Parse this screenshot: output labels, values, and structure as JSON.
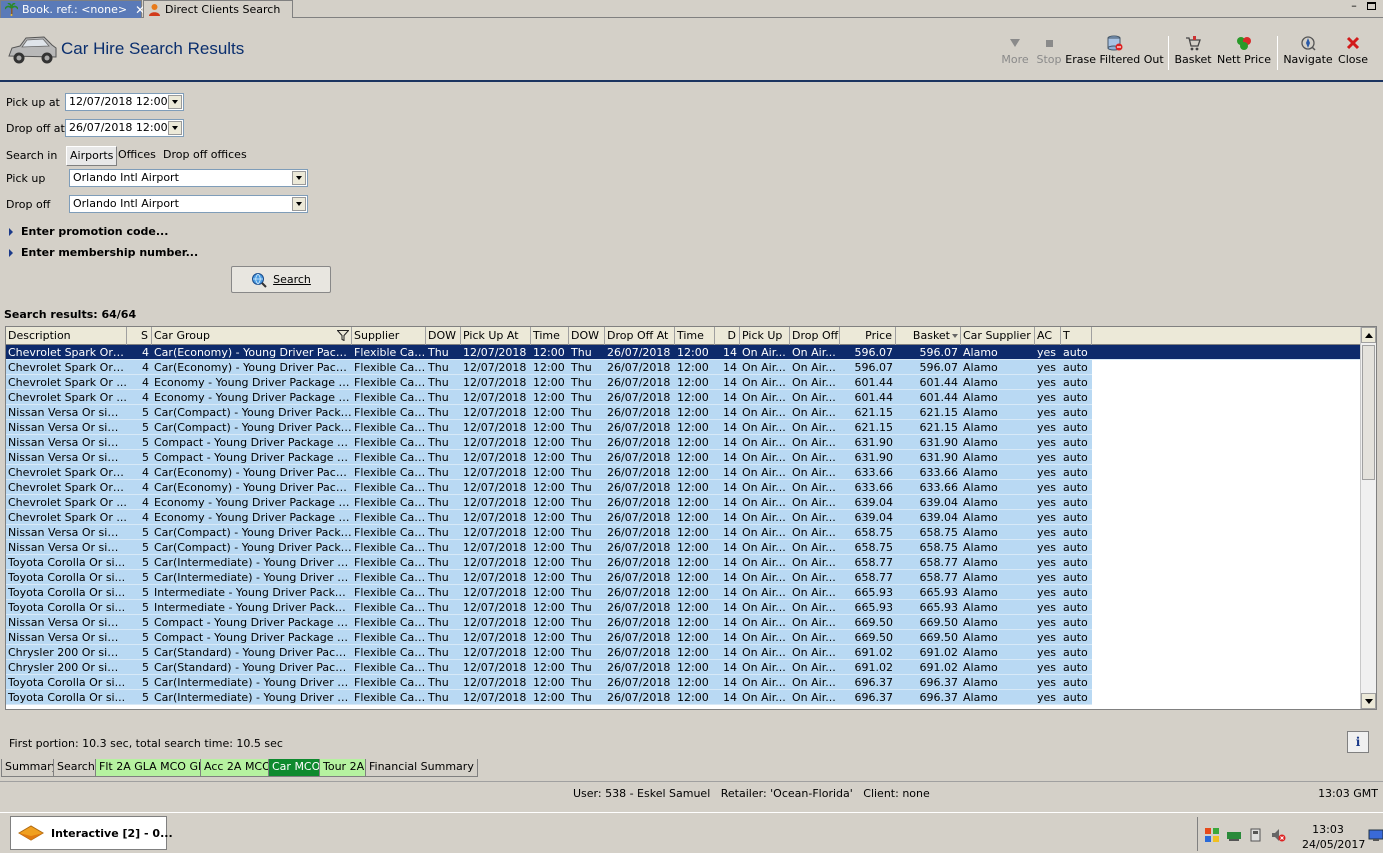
{
  "doc_tabs": [
    {
      "label": "Book. ref.: <none>",
      "active": true
    },
    {
      "label": "Direct Clients Search",
      "active": false
    }
  ],
  "header": {
    "title": "Car Hire Search Results"
  },
  "toolbar": {
    "more": "More",
    "stop": "Stop",
    "erase": "Erase Filtered Out",
    "basket": "Basket",
    "nett": "Nett Price",
    "navigate": "Navigate",
    "close": "Close"
  },
  "form": {
    "pickup_at_label": "Pick up at",
    "pickup_at_value": "12/07/2018 12:00",
    "dropoff_at_label": "Drop off at",
    "dropoff_at_value": "26/07/2018 12:00",
    "search_in_label": "Search in",
    "search_in_options": [
      "Airports",
      "Offices",
      "Drop off offices"
    ],
    "pickup_label": "Pick up",
    "pickup_value": "Orlando Intl Airport",
    "dropoff_label": "Drop off",
    "dropoff_value": "Orlando Intl Airport",
    "promo": "Enter promotion code...",
    "membership": "Enter membership number...",
    "search_button": "Search"
  },
  "results": {
    "count": "Search results: 64/64",
    "columns": [
      "Description",
      "S",
      "Car Group",
      "Supplier",
      "DOW",
      "Pick Up At",
      "Time",
      "DOW",
      "Drop Off At",
      "Time",
      "D",
      "Pick Up",
      "Drop Off",
      "Price",
      "Basket",
      "Car Supplier",
      "AC",
      "T"
    ],
    "rows": [
      [
        "Chevrolet Spark Or si...",
        "4",
        "Car(Economy) - Young Driver Packag...",
        "Flexible Car...",
        "Thu",
        "12/07/2018",
        "12:00",
        "Thu",
        "26/07/2018",
        "12:00",
        "14",
        "On Air...",
        "On Air...",
        "596.07",
        "596.07",
        "Alamo",
        "yes",
        "auto"
      ],
      [
        "Chevrolet Spark Or si...",
        "4",
        "Car(Economy) - Young Driver Packag...",
        "Flexible Car...",
        "Thu",
        "12/07/2018",
        "12:00",
        "Thu",
        "26/07/2018",
        "12:00",
        "14",
        "On Air...",
        "On Air...",
        "596.07",
        "596.07",
        "Alamo",
        "yes",
        "auto"
      ],
      [
        "Chevrolet  Spark Or ...",
        "4",
        "Economy - Young Driver Package (ag...",
        "Flexible Car...",
        "Thu",
        "12/07/2018",
        "12:00",
        "Thu",
        "26/07/2018",
        "12:00",
        "14",
        "On Air...",
        "On Air...",
        "601.44",
        "601.44",
        "Alamo",
        "yes",
        "auto"
      ],
      [
        "Chevrolet  Spark Or ...",
        "4",
        "Economy - Young Driver Package (ag...",
        "Flexible Car...",
        "Thu",
        "12/07/2018",
        "12:00",
        "Thu",
        "26/07/2018",
        "12:00",
        "14",
        "On Air...",
        "On Air...",
        "601.44",
        "601.44",
        "Alamo",
        "yes",
        "auto"
      ],
      [
        "Nissan Versa Or simil...",
        "5",
        "Car(Compact) - Young Driver Package...",
        "Flexible Car...",
        "Thu",
        "12/07/2018",
        "12:00",
        "Thu",
        "26/07/2018",
        "12:00",
        "14",
        "On Air...",
        "On Air...",
        "621.15",
        "621.15",
        "Alamo",
        "yes",
        "auto"
      ],
      [
        "Nissan Versa Or simil...",
        "5",
        "Car(Compact) - Young Driver Package...",
        "Flexible Car...",
        "Thu",
        "12/07/2018",
        "12:00",
        "Thu",
        "26/07/2018",
        "12:00",
        "14",
        "On Air...",
        "On Air...",
        "621.15",
        "621.15",
        "Alamo",
        "yes",
        "auto"
      ],
      [
        "Nissan Versa Or simil...",
        "5",
        "Compact - Young Driver Package (age...",
        "Flexible Car...",
        "Thu",
        "12/07/2018",
        "12:00",
        "Thu",
        "26/07/2018",
        "12:00",
        "14",
        "On Air...",
        "On Air...",
        "631.90",
        "631.90",
        "Alamo",
        "yes",
        "auto"
      ],
      [
        "Nissan Versa Or simil...",
        "5",
        "Compact - Young Driver Package (age...",
        "Flexible Car...",
        "Thu",
        "12/07/2018",
        "12:00",
        "Thu",
        "26/07/2018",
        "12:00",
        "14",
        "On Air...",
        "On Air...",
        "631.90",
        "631.90",
        "Alamo",
        "yes",
        "auto"
      ],
      [
        "Chevrolet Spark Or si...",
        "4",
        "Car(Economy) - Young Driver Packag...",
        "Flexible Car...",
        "Thu",
        "12/07/2018",
        "12:00",
        "Thu",
        "26/07/2018",
        "12:00",
        "14",
        "On Air...",
        "On Air...",
        "633.66",
        "633.66",
        "Alamo",
        "yes",
        "auto"
      ],
      [
        "Chevrolet Spark Or si...",
        "4",
        "Car(Economy) - Young Driver Packag...",
        "Flexible Car...",
        "Thu",
        "12/07/2018",
        "12:00",
        "Thu",
        "26/07/2018",
        "12:00",
        "14",
        "On Air...",
        "On Air...",
        "633.66",
        "633.66",
        "Alamo",
        "yes",
        "auto"
      ],
      [
        "Chevrolet  Spark Or ...",
        "4",
        "Economy - Young Driver Package (ag...",
        "Flexible Car...",
        "Thu",
        "12/07/2018",
        "12:00",
        "Thu",
        "26/07/2018",
        "12:00",
        "14",
        "On Air...",
        "On Air...",
        "639.04",
        "639.04",
        "Alamo",
        "yes",
        "auto"
      ],
      [
        "Chevrolet  Spark Or ...",
        "4",
        "Economy - Young Driver Package (ag...",
        "Flexible Car...",
        "Thu",
        "12/07/2018",
        "12:00",
        "Thu",
        "26/07/2018",
        "12:00",
        "14",
        "On Air...",
        "On Air...",
        "639.04",
        "639.04",
        "Alamo",
        "yes",
        "auto"
      ],
      [
        "Nissan Versa Or simil...",
        "5",
        "Car(Compact) - Young Driver Package...",
        "Flexible Car...",
        "Thu",
        "12/07/2018",
        "12:00",
        "Thu",
        "26/07/2018",
        "12:00",
        "14",
        "On Air...",
        "On Air...",
        "658.75",
        "658.75",
        "Alamo",
        "yes",
        "auto"
      ],
      [
        "Nissan Versa Or simil...",
        "5",
        "Car(Compact) - Young Driver Package...",
        "Flexible Car...",
        "Thu",
        "12/07/2018",
        "12:00",
        "Thu",
        "26/07/2018",
        "12:00",
        "14",
        "On Air...",
        "On Air...",
        "658.75",
        "658.75",
        "Alamo",
        "yes",
        "auto"
      ],
      [
        "Toyota Corolla Or si...",
        "5",
        "Car(Intermediate) - Young Driver Pac...",
        "Flexible Car...",
        "Thu",
        "12/07/2018",
        "12:00",
        "Thu",
        "26/07/2018",
        "12:00",
        "14",
        "On Air...",
        "On Air...",
        "658.77",
        "658.77",
        "Alamo",
        "yes",
        "auto"
      ],
      [
        "Toyota Corolla Or si...",
        "5",
        "Car(Intermediate) - Young Driver Pac...",
        "Flexible Car...",
        "Thu",
        "12/07/2018",
        "12:00",
        "Thu",
        "26/07/2018",
        "12:00",
        "14",
        "On Air...",
        "On Air...",
        "658.77",
        "658.77",
        "Alamo",
        "yes",
        "auto"
      ],
      [
        "Toyota Corolla Or si...",
        "5",
        "Intermediate - Young Driver Package ...",
        "Flexible Car...",
        "Thu",
        "12/07/2018",
        "12:00",
        "Thu",
        "26/07/2018",
        "12:00",
        "14",
        "On Air...",
        "On Air...",
        "665.93",
        "665.93",
        "Alamo",
        "yes",
        "auto"
      ],
      [
        "Toyota Corolla Or si...",
        "5",
        "Intermediate - Young Driver Package ...",
        "Flexible Car...",
        "Thu",
        "12/07/2018",
        "12:00",
        "Thu",
        "26/07/2018",
        "12:00",
        "14",
        "On Air...",
        "On Air...",
        "665.93",
        "665.93",
        "Alamo",
        "yes",
        "auto"
      ],
      [
        "Nissan Versa Or simil...",
        "5",
        "Compact - Young Driver Package (age...",
        "Flexible Car...",
        "Thu",
        "12/07/2018",
        "12:00",
        "Thu",
        "26/07/2018",
        "12:00",
        "14",
        "On Air...",
        "On Air...",
        "669.50",
        "669.50",
        "Alamo",
        "yes",
        "auto"
      ],
      [
        "Nissan Versa Or simil...",
        "5",
        "Compact - Young Driver Package (age...",
        "Flexible Car...",
        "Thu",
        "12/07/2018",
        "12:00",
        "Thu",
        "26/07/2018",
        "12:00",
        "14",
        "On Air...",
        "On Air...",
        "669.50",
        "669.50",
        "Alamo",
        "yes",
        "auto"
      ],
      [
        "Chrysler 200 Or simil...",
        "5",
        "Car(Standard) - Young Driver Packag...",
        "Flexible Car...",
        "Thu",
        "12/07/2018",
        "12:00",
        "Thu",
        "26/07/2018",
        "12:00",
        "14",
        "On Air...",
        "On Air...",
        "691.02",
        "691.02",
        "Alamo",
        "yes",
        "auto"
      ],
      [
        "Chrysler 200 Or simil...",
        "5",
        "Car(Standard) - Young Driver Packag...",
        "Flexible Car...",
        "Thu",
        "12/07/2018",
        "12:00",
        "Thu",
        "26/07/2018",
        "12:00",
        "14",
        "On Air...",
        "On Air...",
        "691.02",
        "691.02",
        "Alamo",
        "yes",
        "auto"
      ],
      [
        "Toyota Corolla Or si...",
        "5",
        "Car(Intermediate) - Young Driver Pac...",
        "Flexible Car...",
        "Thu",
        "12/07/2018",
        "12:00",
        "Thu",
        "26/07/2018",
        "12:00",
        "14",
        "On Air...",
        "On Air...",
        "696.37",
        "696.37",
        "Alamo",
        "yes",
        "auto"
      ],
      [
        "Toyota Corolla Or si...",
        "5",
        "Car(Intermediate) - Young Driver Pac...",
        "Flexible Car...",
        "Thu",
        "12/07/2018",
        "12:00",
        "Thu",
        "26/07/2018",
        "12:00",
        "14",
        "On Air...",
        "On Air...",
        "696.37",
        "696.37",
        "Alamo",
        "yes",
        "auto"
      ]
    ]
  },
  "footer": {
    "timing": "First portion: 10.3 sec, total search time: 10.5 sec",
    "info": "i"
  },
  "bottom_tabs": [
    {
      "label": "Summary",
      "style": "plain"
    },
    {
      "label": "Search",
      "style": "plain"
    },
    {
      "label": "Flt 2A GLA MCO GLA",
      "style": "green"
    },
    {
      "label": "Acc 2A MCO",
      "style": "green"
    },
    {
      "label": "Car MCO",
      "style": "active"
    },
    {
      "label": "Tour 2A",
      "style": "green"
    },
    {
      "label": "Financial Summary",
      "style": "plain"
    }
  ],
  "status": {
    "user": "User: 538 - Eskel Samuel",
    "retailer": "Retailer: 'Ocean-Florida'",
    "client": "Client: none",
    "time": "13:03 GMT"
  },
  "taskbar": {
    "item": "Interactive [2] - 0...",
    "clock_time": "13:03",
    "clock_date": "24/05/2017"
  },
  "colors": {
    "selected_row": "#0d2a6b",
    "row_band": "#b9d9f3",
    "active_tab": "#5a7ab8",
    "green_tab": "#b6f2a0",
    "active_bottom_tab": "#0e8a2e",
    "title_blue": "#0b2f6e"
  }
}
